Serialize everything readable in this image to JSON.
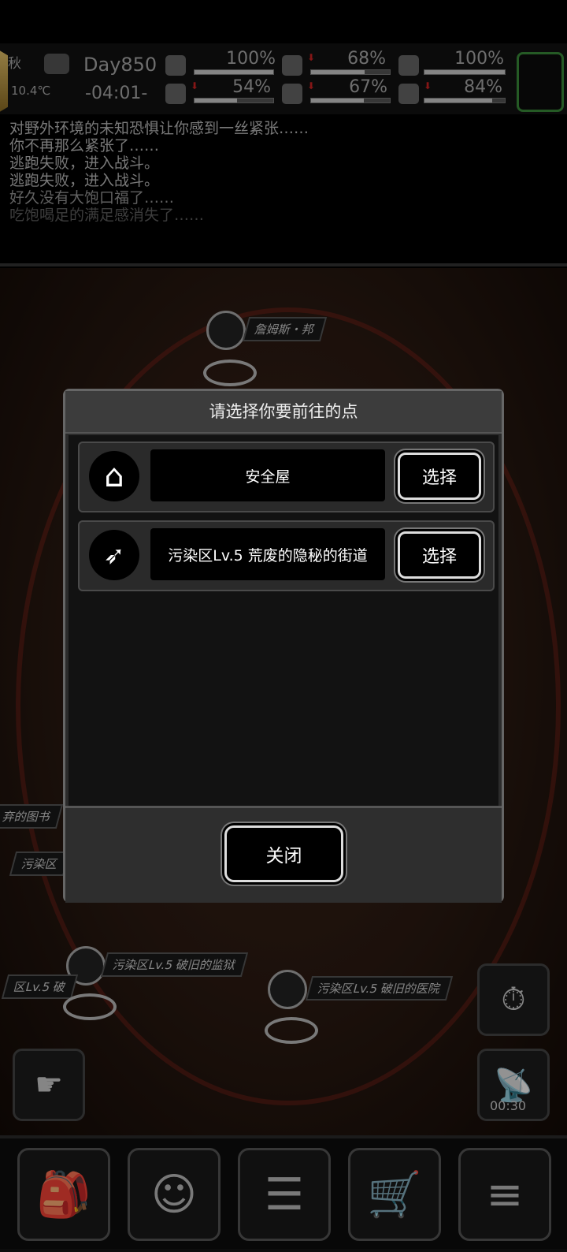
{
  "hud": {
    "season": "秋",
    "temperature": "10.4℃",
    "day": "Day850",
    "time": "-04:01-",
    "stats": [
      {
        "icon": "medkit-icon",
        "percent": "100%",
        "fill": 1.0,
        "arrow": false
      },
      {
        "icon": "stomach-icon",
        "percent": "68%",
        "fill": 0.68,
        "arrow": true
      },
      {
        "icon": "pill-icon",
        "percent": "100%",
        "fill": 1.0,
        "arrow": false
      },
      {
        "icon": "boot-icon",
        "percent": "54%",
        "fill": 0.54,
        "arrow": true
      },
      {
        "icon": "water-drop-icon",
        "percent": "67%",
        "fill": 0.67,
        "arrow": true
      },
      {
        "icon": "heart-icon",
        "percent": "84%",
        "fill": 0.84,
        "arrow": true
      }
    ]
  },
  "log": [
    "对野外环境的未知恐惧让你感到一丝紧张……",
    "你不再那么紧张了……",
    "逃跑失败，进入战斗。",
    "逃跑失败，进入战斗。",
    "好久没有大饱口福了……",
    "吃饱喝足的满足感消失了……"
  ],
  "map": {
    "npc_label": "詹姆斯・邦",
    "labels": {
      "library": "弃的图书",
      "polluted": "污染区",
      "prison": "污染区Lv.5 破旧的监狱",
      "partial": "区Lv.5 破",
      "hospital": "污染区Lv.5 破旧的医院"
    },
    "timer": "00:30"
  },
  "modal": {
    "title": "请选择你要前往的点",
    "options": [
      {
        "icon": "house-icon",
        "name": "安全屋",
        "button": "选择"
      },
      {
        "icon": "road-icon",
        "name": "污染区Lv.5 荒废的隐秘的街道",
        "button": "选择"
      }
    ],
    "close_label": "关闭"
  },
  "colors": {
    "accent_gold": "#e6c36a",
    "ring_red": "#a0281e",
    "slot_green": "#3a8a3a"
  }
}
